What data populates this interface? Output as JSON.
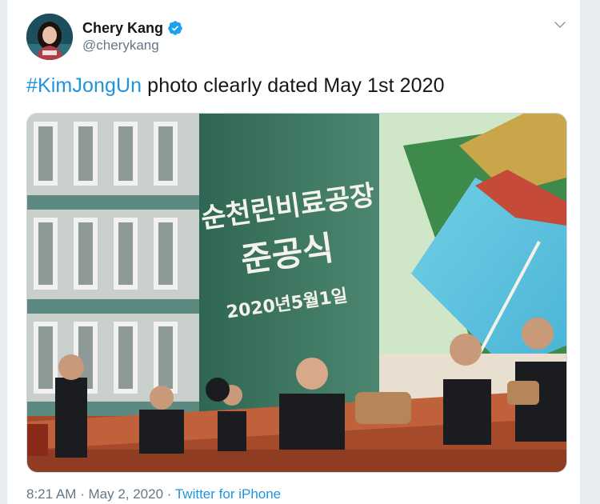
{
  "tweet": {
    "author": {
      "display_name": "Chery Kang",
      "handle": "@cherykang",
      "verified": true,
      "avatar_icon": "profile-photo"
    },
    "text": {
      "hashtag": "#KimJongUn",
      "body": " photo clearly dated May 1st 2020"
    },
    "media": {
      "sign_line1": "순천린비료공장",
      "sign_line2": "준공식",
      "sign_line3": "2020년5월1일"
    },
    "meta": {
      "time": "8:21 AM",
      "separator1": " · ",
      "date": "May 2, 2020",
      "separator2": " · ",
      "source": "Twitter for iPhone"
    }
  },
  "colors": {
    "link": "#1b95e0",
    "text_primary": "#14171a",
    "text_secondary": "#657786",
    "verified": "#1da1f2"
  }
}
